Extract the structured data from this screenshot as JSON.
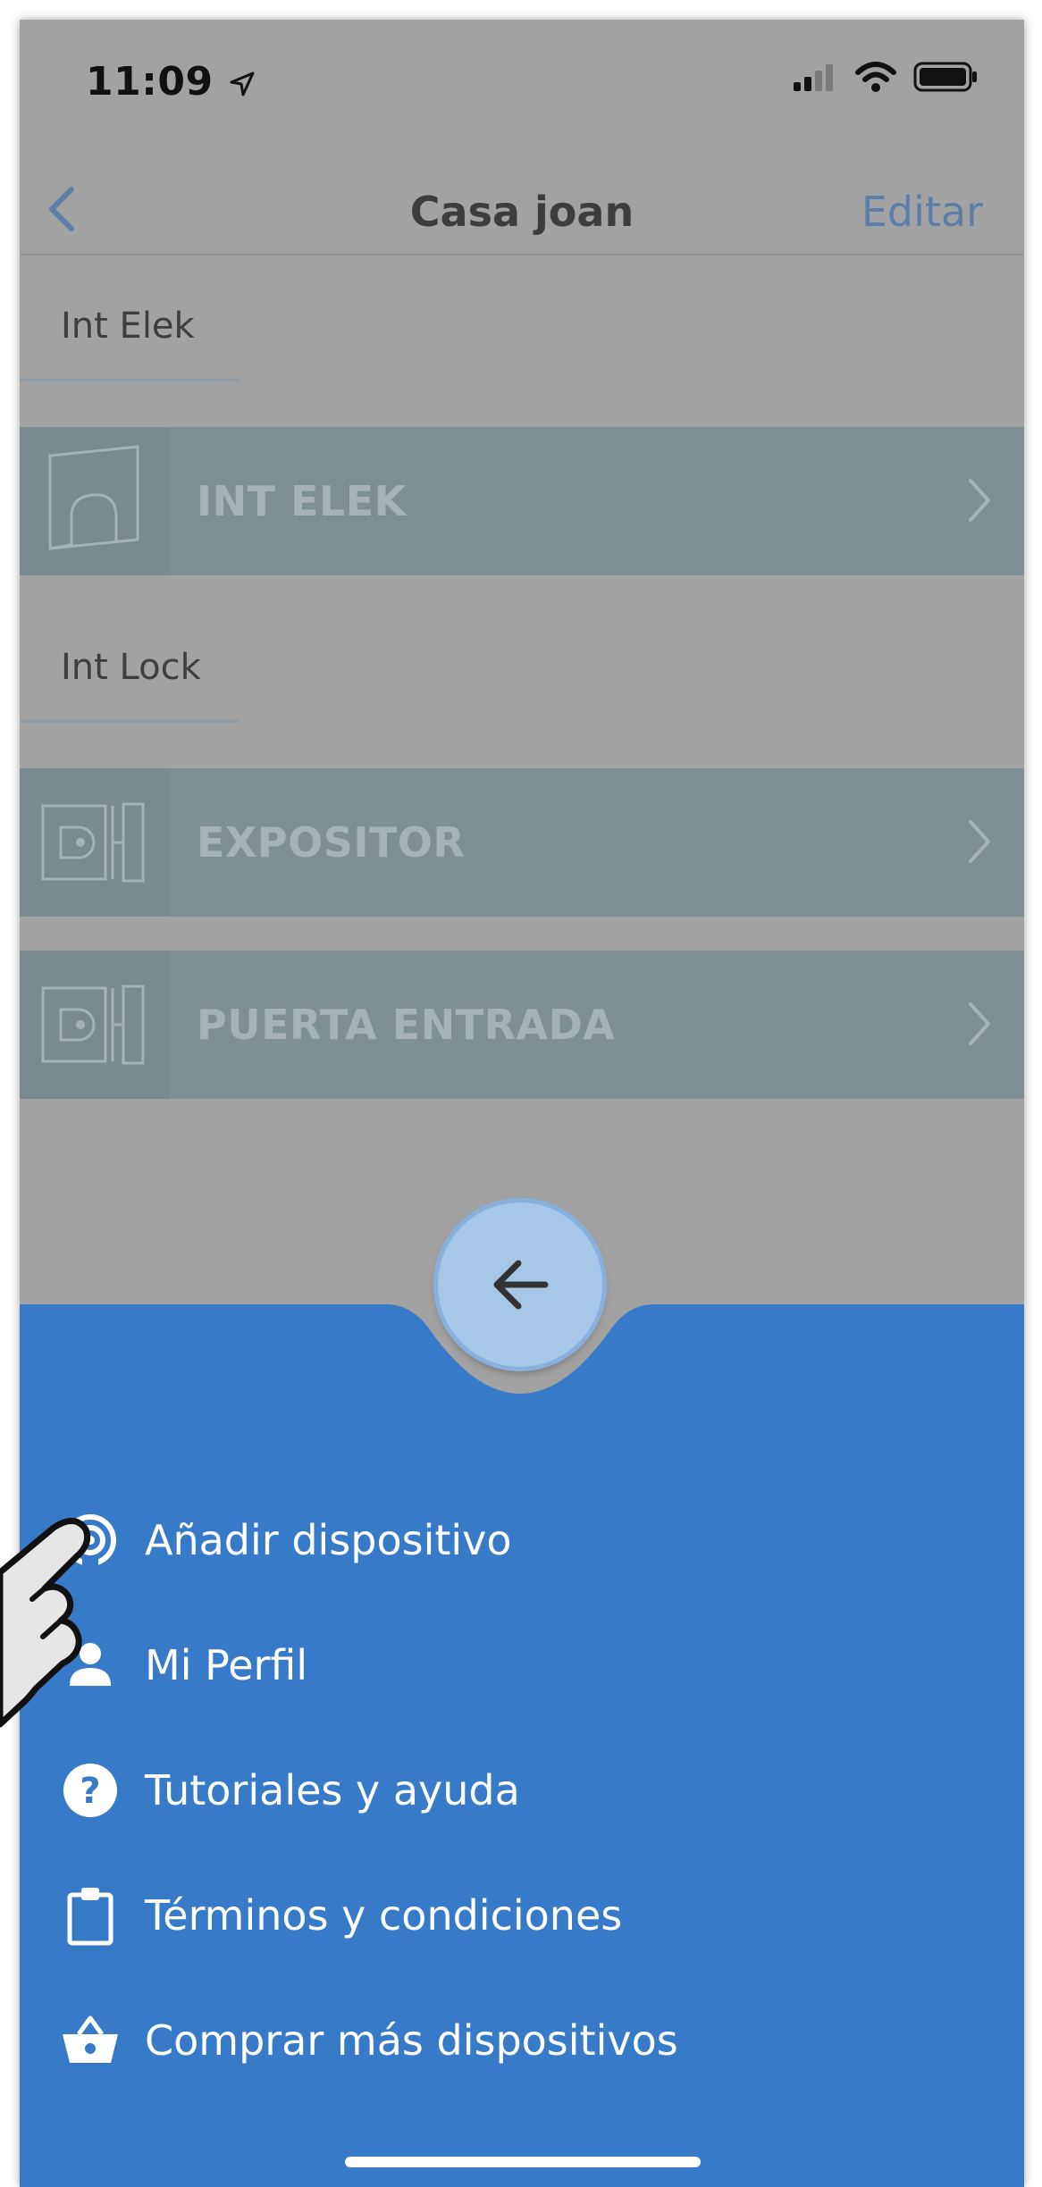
{
  "status_bar": {
    "time": "11:09"
  },
  "nav": {
    "title": "Casa joan",
    "edit_label": "Editar"
  },
  "groups": [
    {
      "label": "Int Elek",
      "devices": [
        {
          "name": "INT ELEK",
          "icon": "door-icon"
        }
      ]
    },
    {
      "label": "Int Lock",
      "devices": [
        {
          "name": "EXPOSITOR",
          "icon": "lock-icon"
        },
        {
          "name": "PUERTA ENTRADA",
          "icon": "lock-icon"
        }
      ]
    }
  ],
  "menu": {
    "items": [
      {
        "label": "Añadir dispositivo",
        "icon": "add-device-icon"
      },
      {
        "label": "Mi Perfil",
        "icon": "person-icon"
      },
      {
        "label": "Tutoriales y ayuda",
        "icon": "help-icon"
      },
      {
        "label": "Términos y condiciones",
        "icon": "clipboard-icon"
      },
      {
        "label": "Comprar más dispositivos",
        "icon": "basket-icon"
      }
    ]
  },
  "colors": {
    "overlay_bg": "#a2a2a2",
    "device_row": "#7f8f93",
    "menu_bg": "#377bc8",
    "fab": "#a6c7e8",
    "accent": "#5d7ea8"
  }
}
